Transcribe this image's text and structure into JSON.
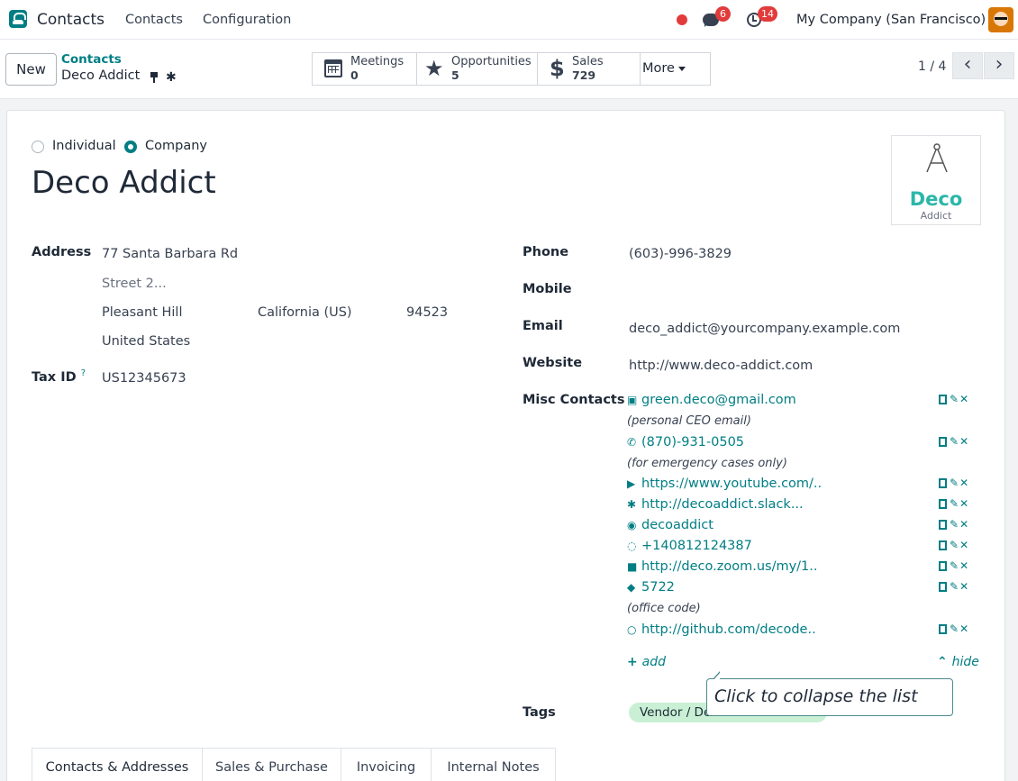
{
  "navbar": {
    "app_name": "Contacts",
    "menu": [
      "Contacts",
      "Configuration"
    ],
    "chat_count": "6",
    "activity_count": "14",
    "company": "My Company (San Francisco)"
  },
  "control": {
    "new_label": "New",
    "breadcrumb_parent": "Contacts",
    "breadcrumb_current": "Deco Addict",
    "smart_buttons": [
      {
        "label": "Meetings",
        "value": "0",
        "icon": "calendar-icon"
      },
      {
        "label": "Opportunities",
        "value": "5",
        "icon": "star-icon"
      },
      {
        "label": "Sales",
        "value": "729",
        "icon": "dollar-icon"
      }
    ],
    "more_label": "More",
    "pager": "1 / 4"
  },
  "form": {
    "type_options": [
      "Individual",
      "Company"
    ],
    "selected_type": "Company",
    "name": "Deco Addict",
    "logo": {
      "word": "Deco",
      "sub": "Addict",
      "color": "#2bb7a9"
    },
    "labels": {
      "address": "Address",
      "tax_id": "Tax ID",
      "tax_tip": "?",
      "phone": "Phone",
      "mobile": "Mobile",
      "email": "Email",
      "website": "Website",
      "misc_contacts": "Misc Contacts",
      "tags": "Tags"
    },
    "address": {
      "street": "77 Santa Barbara Rd",
      "street2_placeholder": "Street 2...",
      "city": "Pleasant Hill",
      "state": "California (US)",
      "zip": "94523",
      "country": "United States"
    },
    "tax_id": "US12345673",
    "phone": "(603)-996-3829",
    "mobile": "",
    "email": "deco_addict@yourcompany.example.com",
    "website": "http://www.deco-addict.com",
    "misc_contacts": [
      {
        "icon": "envelope-icon",
        "text": "green.deco@gmail.com",
        "note": "(personal CEO email)"
      },
      {
        "icon": "phone-icon",
        "text": "(870)-931-0505",
        "note": "(for emergency cases only)"
      },
      {
        "icon": "youtube-icon",
        "text": "https://www.youtube.com/..",
        "note": ""
      },
      {
        "icon": "slack-icon",
        "text": "http://decoaddict.slack...",
        "note": ""
      },
      {
        "icon": "telegram-icon",
        "text": "decoaddict",
        "note": ""
      },
      {
        "icon": "whatsapp-icon",
        "text": "+140812124387",
        "note": ""
      },
      {
        "icon": "video-icon",
        "text": "http://deco.zoom.us/my/1..",
        "note": ""
      },
      {
        "icon": "tag-icon",
        "text": "5722",
        "note": "(office code)"
      },
      {
        "icon": "github-icon",
        "text": "http://github.com/decode..",
        "note": ""
      }
    ],
    "add_label": "add",
    "hide_label": "hide",
    "tag": "Vendor / Desk Manufacturers",
    "tooltip": "Click to collapse the list"
  },
  "tabs": [
    "Contacts & Addresses",
    "Sales & Purchase",
    "Invoicing",
    "Internal Notes"
  ],
  "colors": {
    "accent": "#017e84",
    "badge": "#e23b3b",
    "tag": "#c9f0d4"
  }
}
